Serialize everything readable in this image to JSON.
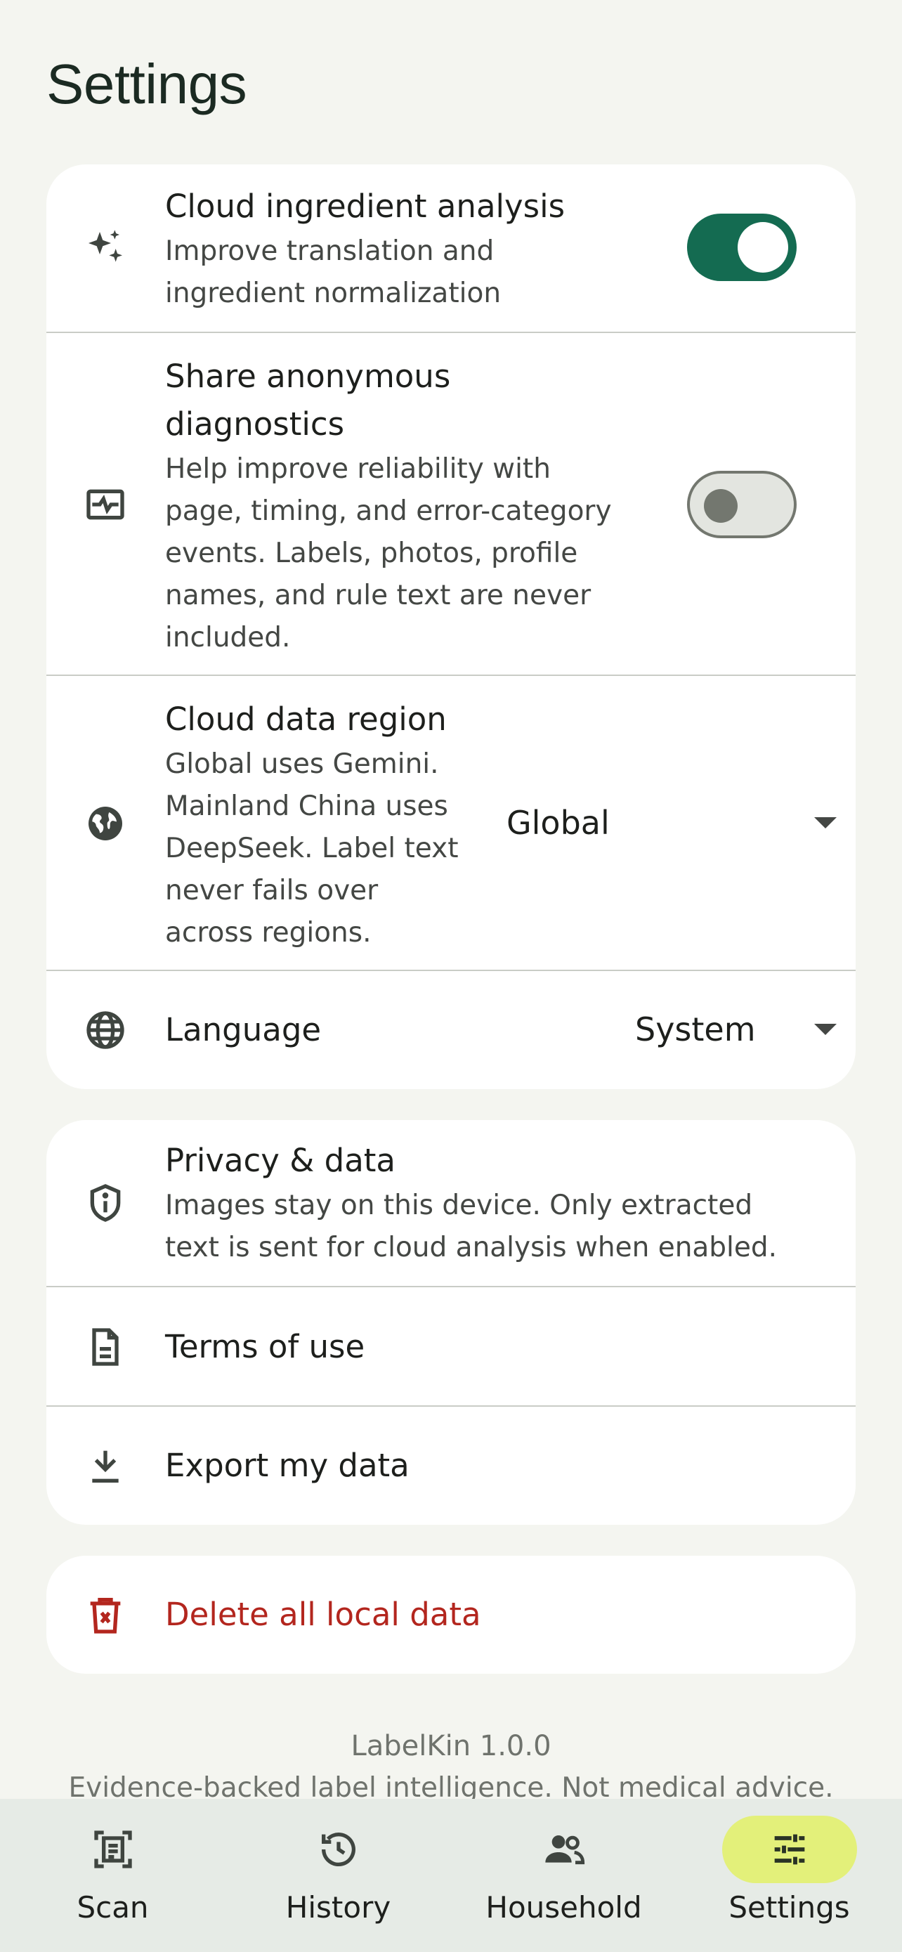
{
  "page": {
    "title": "Settings"
  },
  "cloud_analysis": {
    "title": "Cloud ingredient analysis",
    "subtitle_lines": [
      "Improve translation and",
      "ingredient normalization"
    ],
    "enabled": true,
    "icon": "sparkles-icon"
  },
  "diagnostics": {
    "title_lines": [
      "Share anonymous",
      "diagnostics"
    ],
    "subtitle_lines": [
      "Help improve reliability with",
      "page, timing, and error-category",
      "events. Labels, photos, profile",
      "names, and rule text are never",
      "included."
    ],
    "enabled": false,
    "icon": "monitor-heartbeat-icon"
  },
  "region": {
    "title": "Cloud data region",
    "subtitle_lines": [
      "Global uses Gemini.",
      "Mainland China uses",
      "DeepSeek. Label text",
      "never fails over",
      "across regions."
    ],
    "value": "Global",
    "icon": "globe-filled-icon"
  },
  "language": {
    "title": "Language",
    "value": "System",
    "icon": "globe-outline-icon"
  },
  "privacy": {
    "title": "Privacy & data",
    "subtitle_lines": [
      "Images stay on this device. Only extracted",
      "text is sent for cloud analysis when enabled."
    ],
    "icon": "shield-info-icon"
  },
  "terms": {
    "title": "Terms of use",
    "icon": "document-icon"
  },
  "export": {
    "title": "Export my data",
    "icon": "download-icon"
  },
  "delete": {
    "title": "Delete all local data",
    "icon": "trash-icon",
    "color": "#b3261e"
  },
  "footer": {
    "version": "LabelKin 1.0.0",
    "tagline": "Evidence-backed label intelligence. Not medical advice."
  },
  "nav": {
    "items": [
      {
        "label": "Scan",
        "icon": "scan-document-icon",
        "active": false
      },
      {
        "label": "History",
        "icon": "history-icon",
        "active": false
      },
      {
        "label": "Household",
        "icon": "people-icon",
        "active": false
      },
      {
        "label": "Settings",
        "icon": "tune-sliders-icon",
        "active": true
      }
    ]
  },
  "colors": {
    "accent": "#146b51",
    "nav_active": "#e3f07a",
    "danger": "#b3261e",
    "background": "#f4f5f0"
  }
}
